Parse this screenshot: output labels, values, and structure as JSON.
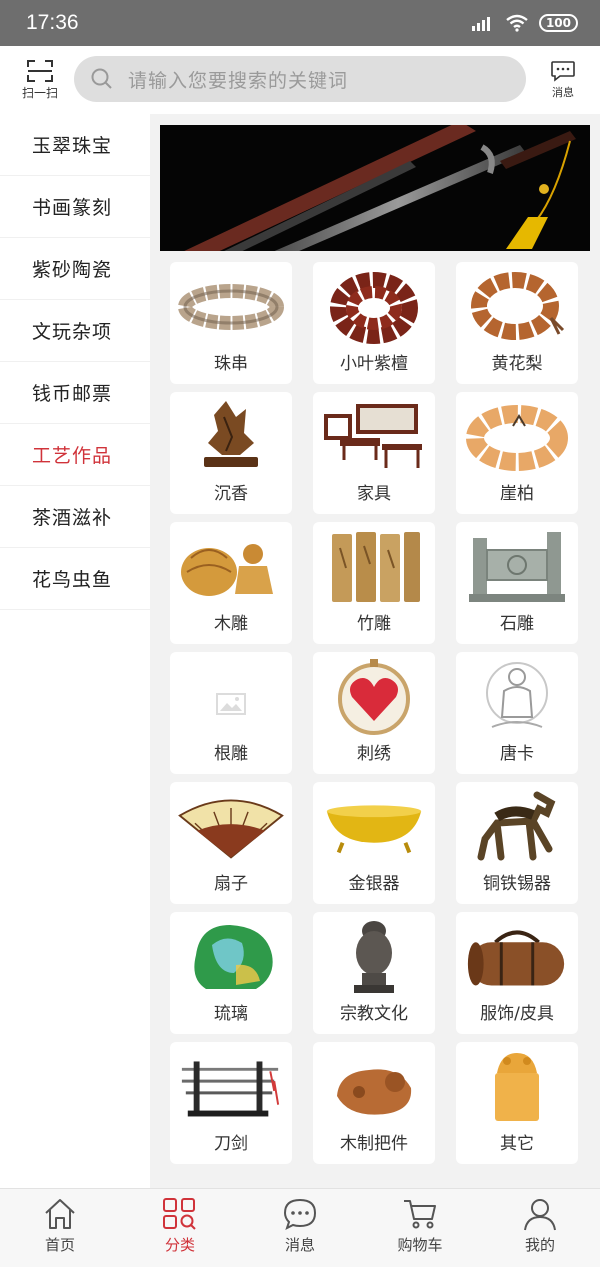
{
  "status_bar": {
    "time": "17:36",
    "battery": "100"
  },
  "header": {
    "scan_label": "扫一扫",
    "search_placeholder": "请输入您要搜索的关键词",
    "message_label": "消息"
  },
  "sidebar": {
    "items": [
      {
        "label": "玉翠珠宝"
      },
      {
        "label": "书画篆刻"
      },
      {
        "label": "紫砂陶瓷"
      },
      {
        "label": "文玩杂项"
      },
      {
        "label": "钱币邮票"
      },
      {
        "label": "工艺作品"
      },
      {
        "label": "茶酒滋补"
      },
      {
        "label": "花鸟虫鱼"
      }
    ],
    "active_index": 5
  },
  "categories": [
    {
      "label": "珠串"
    },
    {
      "label": "小叶紫檀"
    },
    {
      "label": "黄花梨"
    },
    {
      "label": "沉香"
    },
    {
      "label": "家具"
    },
    {
      "label": "崖柏"
    },
    {
      "label": "木雕"
    },
    {
      "label": "竹雕"
    },
    {
      "label": "石雕"
    },
    {
      "label": "根雕"
    },
    {
      "label": "刺绣"
    },
    {
      "label": "唐卡"
    },
    {
      "label": "扇子"
    },
    {
      "label": "金银器"
    },
    {
      "label": "铜铁锡器"
    },
    {
      "label": "琉璃"
    },
    {
      "label": "宗教文化"
    },
    {
      "label": "服饰/皮具"
    },
    {
      "label": "刀剑"
    },
    {
      "label": "木制把件"
    },
    {
      "label": "其它"
    }
  ],
  "tabbar": {
    "items": [
      {
        "label": "首页"
      },
      {
        "label": "分类"
      },
      {
        "label": "消息"
      },
      {
        "label": "购物车"
      },
      {
        "label": "我的"
      }
    ],
    "active_index": 1
  },
  "colors": {
    "accent": "#d0333a",
    "background": "#f2f2f2",
    "status_bar": "#6e6e6e"
  }
}
